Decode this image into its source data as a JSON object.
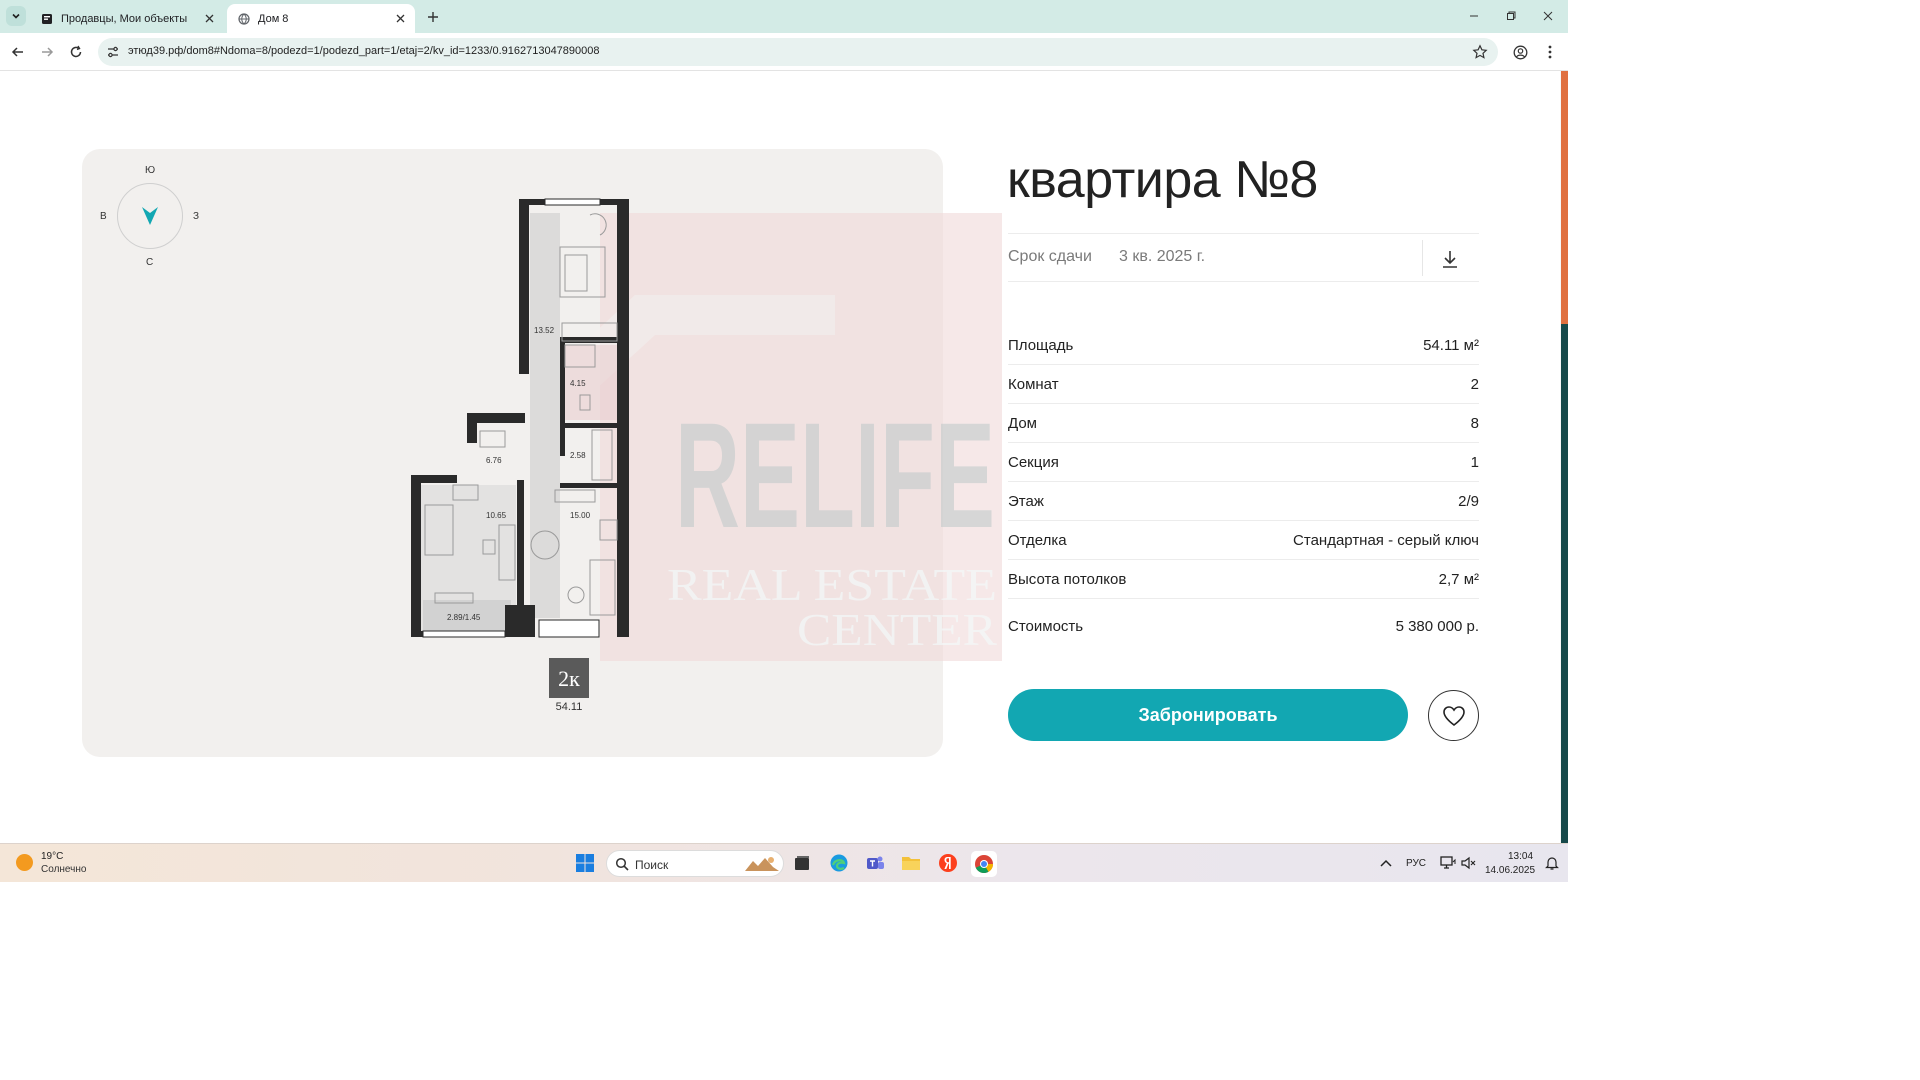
{
  "browser": {
    "tabs": [
      {
        "title": "Продавцы, Мои объекты"
      },
      {
        "title": "Дом 8"
      }
    ],
    "url": "этюд39.рф/dom8#Ndoma=8/podezd=1/podezd_part=1/etaj=2/kv_id=1233/0.9162713047890008"
  },
  "plan": {
    "compass": {
      "north": "С",
      "south": "Ю",
      "east": "В",
      "west": "З"
    },
    "rooms": [
      {
        "area": "13.52"
      },
      {
        "area": "4.15"
      },
      {
        "area": "2.58"
      },
      {
        "area": "6.76"
      },
      {
        "area": "10.65"
      },
      {
        "area": "15.00"
      },
      {
        "area": "2.89/1.45"
      }
    ],
    "watermark": {
      "brand": "RELIFE",
      "line1": "REAL ESTATE",
      "line2": "CENTER"
    },
    "type_badge": "2к",
    "total_area": "54.11"
  },
  "apartment": {
    "title": "квартира №8",
    "deadline_label": "Срок сдачи",
    "deadline_value": "3 кв. 2025 г.",
    "specs": [
      {
        "label": "Площадь",
        "value": "54.11 м²"
      },
      {
        "label": "Комнат",
        "value": "2"
      },
      {
        "label": "Дом",
        "value": "8"
      },
      {
        "label": "Секция",
        "value": "1"
      },
      {
        "label": "Этаж",
        "value": "2/9"
      },
      {
        "label": "Отделка",
        "value": "Стандартная - серый ключ"
      },
      {
        "label": "Высота потолков",
        "value": "2,7 м²"
      }
    ],
    "price_label": "Стоимость",
    "price_value": "5 380 000 р.",
    "book_label": "Забронировать"
  },
  "taskbar": {
    "weather_temp": "19°C",
    "weather_desc": "Солнечно",
    "search_label": "Поиск",
    "lang": "РУС",
    "time": "13:04",
    "date": "14.06.2025"
  },
  "colors": {
    "accent": "#12a7b2",
    "scroll_thumb": "#e07040",
    "wall": "#2a2a2a"
  }
}
